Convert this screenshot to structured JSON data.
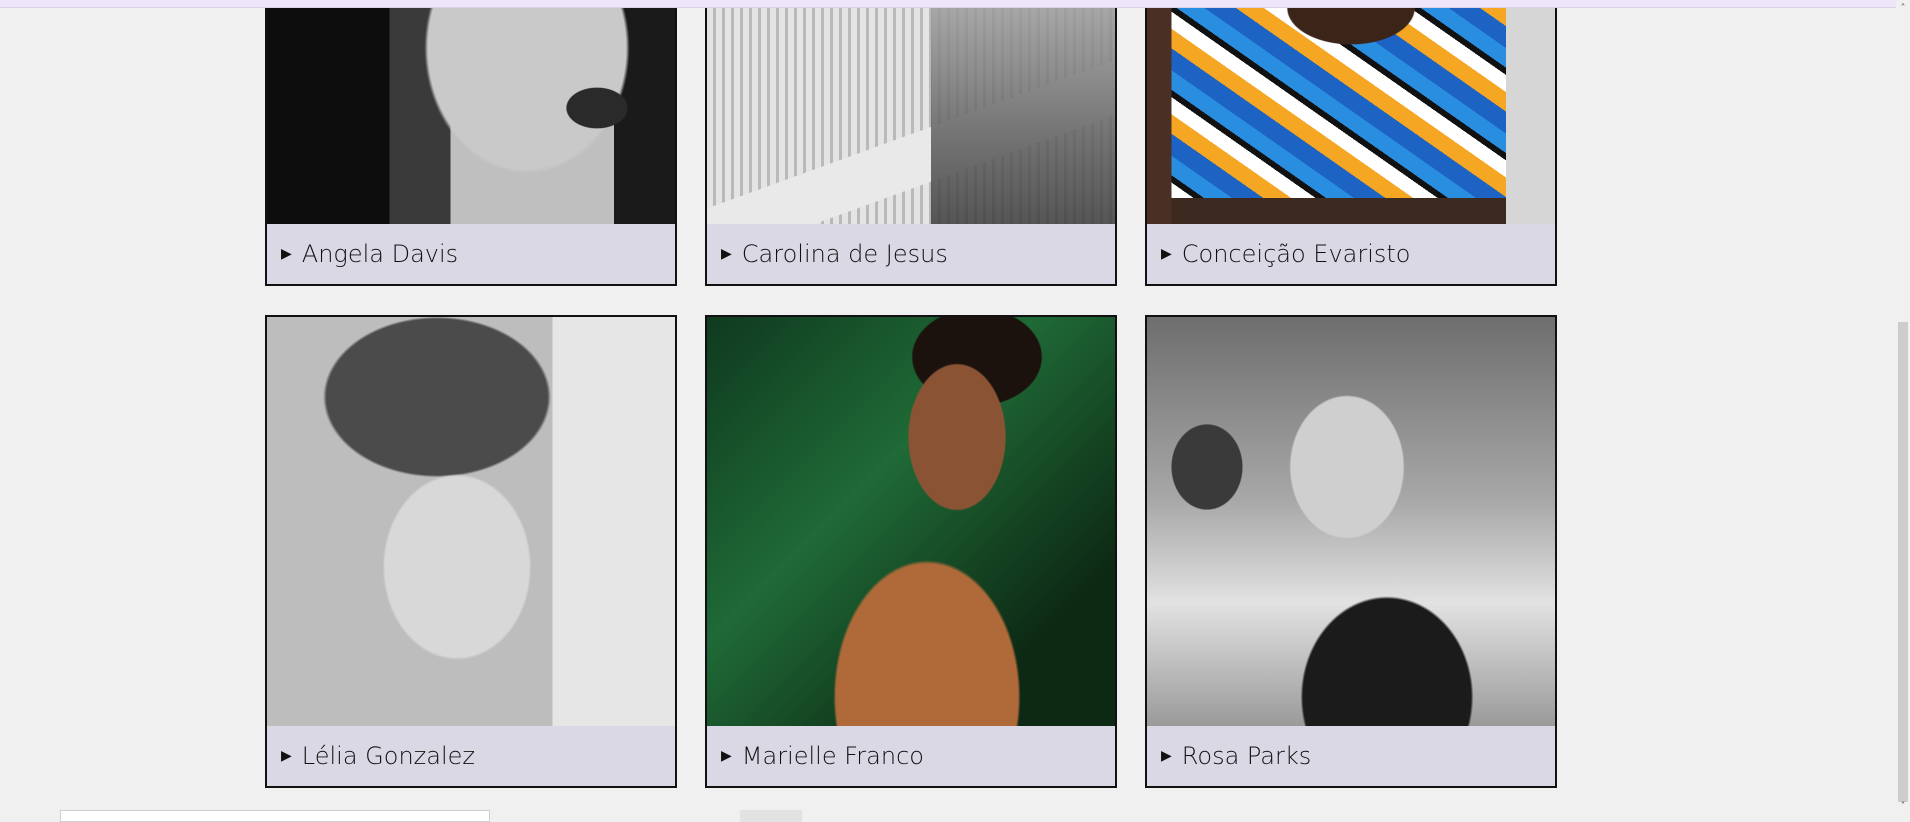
{
  "cards": [
    {
      "name": "Angela Davis",
      "photo_icon": "portrait-photo"
    },
    {
      "name": "Carolina de Jesus",
      "photo_icon": "portrait-photo"
    },
    {
      "name": "Conceição Evaristo",
      "photo_icon": "portrait-photo"
    },
    {
      "name": "Lélia Gonzalez",
      "photo_icon": "portrait-photo"
    },
    {
      "name": "Marielle Franco",
      "photo_icon": "portrait-photo"
    },
    {
      "name": "Rosa Parks",
      "photo_icon": "portrait-photo"
    }
  ],
  "caption_marker": "▶",
  "colors": {
    "page_background": "#f0f0f0",
    "caption_background": "#dbd8e6",
    "card_border": "#111111",
    "top_strip": "#ece6f8"
  },
  "scrollbar": {
    "up_arrow": "˄",
    "down_arrow": "˅"
  }
}
